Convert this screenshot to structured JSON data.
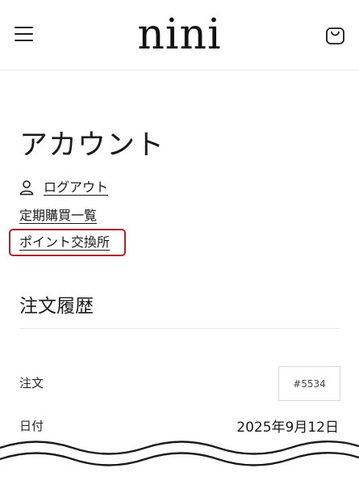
{
  "header": {
    "logo": "nini",
    "menu_icon": "hamburger-menu-icon",
    "cart_icon": "shopping-bag-icon"
  },
  "account": {
    "title": "アカウント",
    "logout_label": "ログアウト",
    "subscription_label": "定期購買一覧",
    "points_label": "ポイント交換所"
  },
  "orders": {
    "title": "注文履歴",
    "order_label": "注文",
    "order_number": "#5534",
    "date_label": "日付",
    "date_value": "2025年9月12日"
  },
  "colors": {
    "text": "#1a1a1a",
    "highlight_border": "#b0232b",
    "divider": "#e6e6e6"
  }
}
